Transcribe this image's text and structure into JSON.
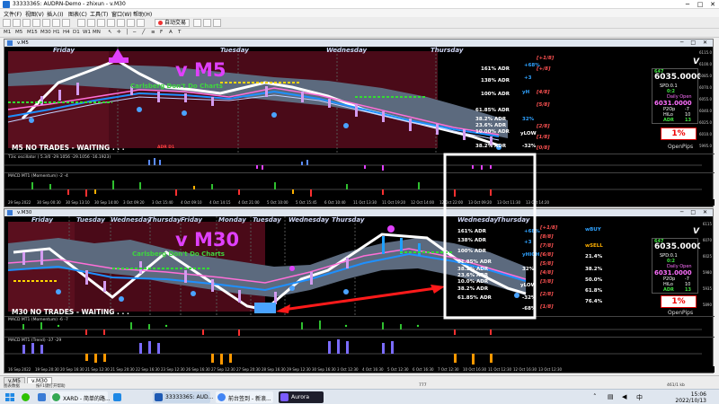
{
  "window": {
    "title": "33333365: AUDRN-Demo - zhixun - v.M30",
    "minimize": "─",
    "maximize": "□",
    "close": "✕"
  },
  "menu": [
    "文件(F)",
    "视图(V)",
    "插入(I)",
    "图表(C)",
    "工具(T)",
    "窗口(W)",
    "帮助(H)"
  ],
  "toolbar": {
    "autotrade_label": "自动交易"
  },
  "timeframes": [
    "M1",
    "M5",
    "M15",
    "M30",
    "H1",
    "H4",
    "D1",
    "W1",
    "MN"
  ],
  "chart_m5": {
    "window_title": "v.M5",
    "tf_label": "v M5",
    "watermark": "Carlsberg Don't Do Charts",
    "days": [
      "Friday",
      "Tuesday",
      "Wednesday",
      "Thursday"
    ],
    "status": "M5  NO TRADES - WAITING . . .",
    "adr_tag": "ADR D1",
    "osc_label": "T3ic oscillator ( 5.3/0 -29.1056 -29.1056 -16.1923)",
    "macd_label": "MACD MT1 (Momentum) -2 -4",
    "levels": [
      {
        "text": "161% ADR",
        "cls": "w"
      },
      {
        "text": "138% ADR",
        "cls": "w"
      },
      {
        "text": "100% ADR",
        "cls": "w"
      },
      {
        "text": "61.85% ADR",
        "cls": "w"
      },
      {
        "text": "38.2% ADR",
        "cls": "w"
      },
      {
        "text": "23.6% ADR",
        "cls": "w"
      },
      {
        "text": "10.00% ADR",
        "cls": "w"
      },
      {
        "text": "38.2% ADR",
        "cls": "w"
      }
    ],
    "right_levels": [
      {
        "text": "+68%",
        "cls": "c"
      },
      {
        "text": "+3",
        "cls": "c"
      },
      {
        "text": "yH",
        "cls": "c"
      },
      {
        "text": "32%",
        "cls": "c"
      },
      {
        "text": "yLOW",
        "cls": "c"
      },
      {
        "text": "-32%",
        "cls": "c"
      }
    ],
    "fracs": [
      "[+1/8]",
      "[+/8]",
      "[4/8]",
      "[5/8]",
      "[2/8]",
      "[1/8]",
      "[0/8]"
    ],
    "info": {
      "price_top": "647",
      "price": "6035.0000",
      "spd": "SPD:0.1",
      "spd_v": "0:2",
      "daily_open_lbl": "Daily Open",
      "daily_open": "6031.0000",
      "p2op": "P2Op",
      "p2op_v": "-7",
      "hilo": "HiLo",
      "hilo_v": "10",
      "adr": "ADR",
      "adr_v": "13",
      "pct": "1%",
      "openpips": "OpenPips",
      "badge": "V"
    },
    "xaxis": [
      "29 Sep 2022",
      "30 Sep 00:30",
      "30 Sep 13:10",
      "30 Sep 14:00",
      "3 Oct 09:20",
      "3 Oct 15:40",
      "4 Oct 09:10",
      "4 Oct 14:15",
      "4 Oct 21:00",
      "5 Oct 10:00",
      "5 Oct 15:45",
      "6 Oct 10:40",
      "11 Oct 13:30",
      "11 Oct 19:20",
      "12 Oct 14:00",
      "12 Oct 22:00",
      "13 Oct 09:20",
      "13 Oct 11:30",
      "13 Oct 14:20"
    ],
    "yaxis": [
      "6115.0",
      "6100.0",
      "6085.0",
      "6070.0",
      "6055.0",
      "6040.0",
      "6025.0",
      "6010.0",
      "5995.0"
    ]
  },
  "chart_m30": {
    "window_title": "v.M30",
    "tf_label": "v M30",
    "watermark": "Carlsberg Don't Do Charts",
    "days": [
      "Friday",
      "Tuesday",
      "Wednesday",
      "Thursday",
      "Friday",
      "Monday",
      "Tuesday",
      "Wednesday",
      "Thursday",
      "Wednesday",
      "Thursday"
    ],
    "status": "M30  NO TRADES - WAITING . . .",
    "macd_label": "MACD MT1 (Momentum) -6 -7",
    "trend_label": "MACD MT1 (Trend) -37 -29",
    "levels": [
      "161% ADR",
      "138% ADR",
      "100% ADR",
      "61.85% ADR",
      "38.2% ADR",
      "23.6% ADR",
      "10.0% ADR",
      "38.2% ADR",
      "61.85% ADR"
    ],
    "right_levels": [
      "+68%",
      "+3",
      "yHIGH",
      "32%",
      "yLOW",
      "-32%",
      "-68%"
    ],
    "fracs": [
      "[+1/8]",
      "[8/8]",
      "[7/8]",
      "[6/8]",
      "[5/8]",
      "[4/8]",
      "[3/8]",
      "[2/8]",
      "[1/8]"
    ],
    "fib": [
      "wBUY",
      "wSELL",
      "21.4%",
      "38.2%",
      "50.0%",
      "61.8%",
      "76.4%"
    ],
    "info": {
      "price_top": "647",
      "price": "6035.0000",
      "spd": "SPD:0.1",
      "spd_v": "0:2",
      "daily_open_lbl": "Daily Open",
      "daily_open": "6031.0000",
      "p2op": "P2Op",
      "p2op_v": "-7",
      "hilo": "HiLo",
      "hilo_v": "10",
      "adr": "ADR",
      "adr_v": "13",
      "pct": "1%",
      "openpips": "OpenPips",
      "badge": "V"
    },
    "xaxis": [
      "16 Sep 2022",
      "19 Sep 20:30",
      "20 Sep 16:30",
      "21 Sep 12:30",
      "21 Sep 20:30",
      "22 Sep 16:30",
      "23 Sep 12:30",
      "26 Sep 16:30",
      "27 Sep 12:30",
      "27 Sep 20:30",
      "28 Sep 16:30",
      "29 Sep 12:30",
      "30 Sep 16:30",
      "3 Oct 12:30",
      "4 Oct 16:30",
      "5 Oct 12:30",
      "6 Oct 16:30",
      "7 Oct 12:30",
      "10 Oct 16:30",
      "11 Oct 12:30",
      "12 Oct 16:30",
      "13 Oct 12:30"
    ],
    "yaxis": [
      "6115",
      "6070",
      "6025",
      "5980",
      "5935",
      "5890"
    ]
  },
  "tabs": [
    "v.M5",
    "v.M30"
  ],
  "statusbar": {
    "left": "图表数据",
    "help": "按F1键打开帮助",
    "counter": "777",
    "bars": "461/1 kb"
  },
  "taskbar": {
    "items": [
      "XARD - 简单的路...",
      "33333365: AUD...",
      "前台签到 - 新浪...",
      "Aurora"
    ],
    "time": "15:06",
    "date": "2022/10/13"
  },
  "colors": {
    "chart_bg": "#000000",
    "cloud": "#5c6a7e",
    "dark_red": "#5a0f1e",
    "magenta": "#e040fb",
    "red_arrow": "#ff1a1a",
    "highlight_box": "#ffffff"
  }
}
